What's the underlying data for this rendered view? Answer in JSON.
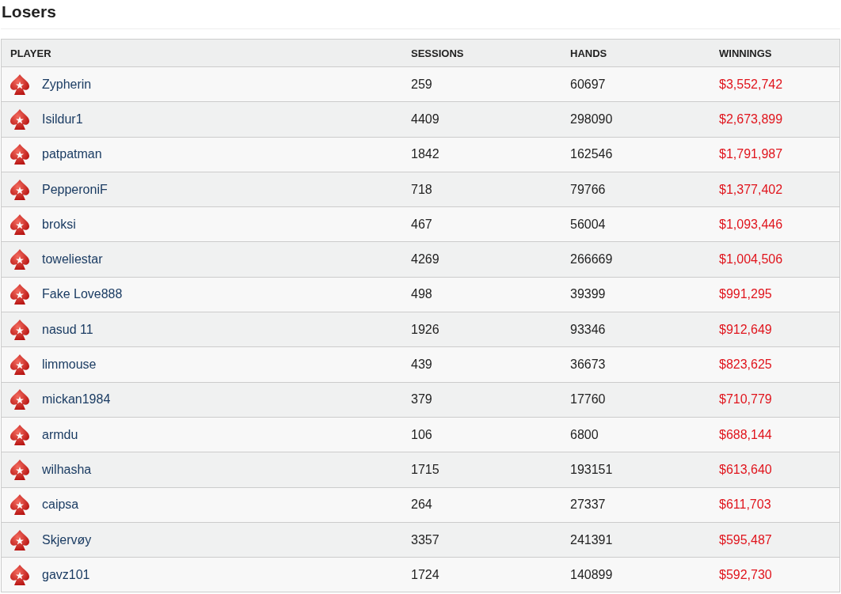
{
  "title": "Losers",
  "table": {
    "columns": [
      "PLAYER",
      "SESSIONS",
      "HANDS",
      "WINNINGS"
    ],
    "rows": [
      {
        "player": "Zypherin",
        "sessions": "259",
        "hands": "60697",
        "winnings": "$3,552,742"
      },
      {
        "player": "Isildur1",
        "sessions": "4409",
        "hands": "298090",
        "winnings": "$2,673,899"
      },
      {
        "player": "patpatman",
        "sessions": "1842",
        "hands": "162546",
        "winnings": "$1,791,987"
      },
      {
        "player": "PepperoniF",
        "sessions": "718",
        "hands": "79766",
        "winnings": "$1,377,402"
      },
      {
        "player": "broksi",
        "sessions": "467",
        "hands": "56004",
        "winnings": "$1,093,446"
      },
      {
        "player": "toweliestar",
        "sessions": "4269",
        "hands": "266669",
        "winnings": "$1,004,506"
      },
      {
        "player": "Fake Love888",
        "sessions": "498",
        "hands": "39399",
        "winnings": "$991,295"
      },
      {
        "player": "nasud 11",
        "sessions": "1926",
        "hands": "93346",
        "winnings": "$912,649"
      },
      {
        "player": "limmouse",
        "sessions": "439",
        "hands": "36673",
        "winnings": "$823,625"
      },
      {
        "player": "mickan1984",
        "sessions": "379",
        "hands": "17760",
        "winnings": "$710,779"
      },
      {
        "player": "armdu",
        "sessions": "106",
        "hands": "6800",
        "winnings": "$688,144"
      },
      {
        "player": "wilhasha",
        "sessions": "1715",
        "hands": "193151",
        "winnings": "$613,640"
      },
      {
        "player": "caipsa",
        "sessions": "264",
        "hands": "27337",
        "winnings": "$611,703"
      },
      {
        "player": "Skjervøy",
        "sessions": "3357",
        "hands": "241391",
        "winnings": "$595,487"
      },
      {
        "player": "gavz101",
        "sessions": "1724",
        "hands": "140899",
        "winnings": "$592,730"
      }
    ]
  }
}
